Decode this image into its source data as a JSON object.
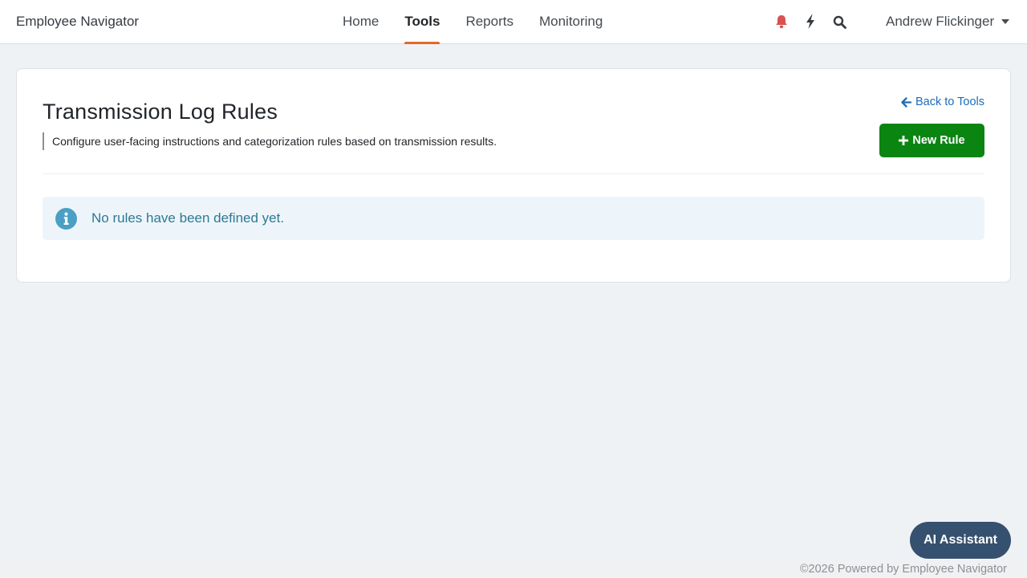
{
  "brand": "Employee Navigator",
  "nav": {
    "items": [
      {
        "label": "Home",
        "active": false
      },
      {
        "label": "Tools",
        "active": true
      },
      {
        "label": "Reports",
        "active": false
      },
      {
        "label": "Monitoring",
        "active": false
      }
    ],
    "icons": [
      "bell-icon",
      "bolt-icon",
      "search-icon"
    ],
    "user_name": "Andrew Flickinger"
  },
  "page": {
    "title": "Transmission Log Rules",
    "subtitle": "Configure user-facing instructions and categorization rules based on transmission results.",
    "back_link": "Back to Tools",
    "new_rule_label": "New Rule",
    "empty_message": "No rules have been defined yet."
  },
  "ai_assistant_label": "AI Assistant",
  "footer_text": "©2026 Powered by Employee Navigator",
  "colors": {
    "accent_active_tab": "#e06a2b",
    "primary_button": "#0b8512",
    "link": "#1e6bb8",
    "info_text": "#2b7a93",
    "bell": "#d9534f",
    "ai_button": "#36506f"
  }
}
